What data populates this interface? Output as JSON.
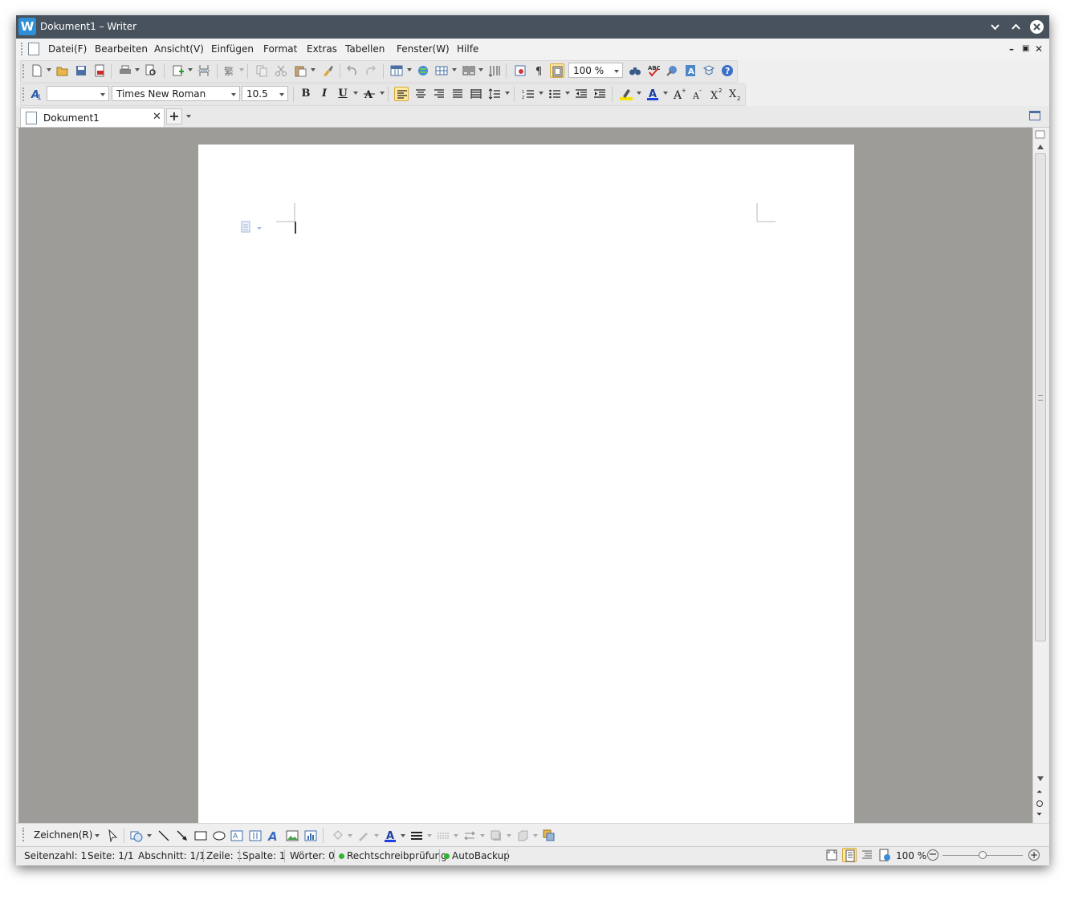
{
  "window": {
    "title": "Dokument1 – Writer",
    "controls": [
      "minimize",
      "maximize",
      "close"
    ]
  },
  "menu": {
    "items": [
      "Datei(F)",
      "Bearbeiten",
      "Ansicht(V)",
      "Einfügen",
      "Format",
      "Extras",
      "Tabellen",
      "Fenster(W)",
      "Hilfe"
    ]
  },
  "toolbar_standard": {
    "zoom_value": "100 %",
    "icons": [
      "new-document",
      "open-folder",
      "save",
      "export-pdf",
      "print",
      "print-preview",
      "insert-object",
      "page-break",
      "chinese-convert",
      "copy",
      "cut",
      "paste",
      "format-painter",
      "undo",
      "redo",
      "insert-table",
      "hyperlink",
      "table-grid",
      "columns",
      "text-direction",
      "navigator",
      "nonprinting-chars",
      "text-boundaries",
      "find",
      "spellcheck",
      "autocorrect",
      "text-box",
      "help-tip",
      "help"
    ]
  },
  "toolbar_format": {
    "style_value": "",
    "font_name": "Times New Roman",
    "font_size": "10.5",
    "bold": "B",
    "italic": "I",
    "underline": "U",
    "active_alignment": "align-left"
  },
  "tabs": {
    "active": "Dokument1"
  },
  "draw_toolbar": {
    "label": "Zeichnen(R)"
  },
  "status": {
    "page_count": "Seitenzahl: 1",
    "page": "Seite: 1/1",
    "section": "Abschnitt: 1/1",
    "line": "Zeile: 1",
    "column": "Spalte: 1",
    "words": "Wörter: 0",
    "spellcheck": "Rechtschreibprüfung",
    "autobackup": "AutoBackup",
    "zoom": "100 %",
    "zoom_fraction": 0.5
  },
  "colors": {
    "titlebar": "#47525c",
    "workspace": "#9e9c98",
    "accent_blue": "#2e8fd6",
    "status_green": "#2fb52f",
    "active_button": "#fde89b"
  }
}
